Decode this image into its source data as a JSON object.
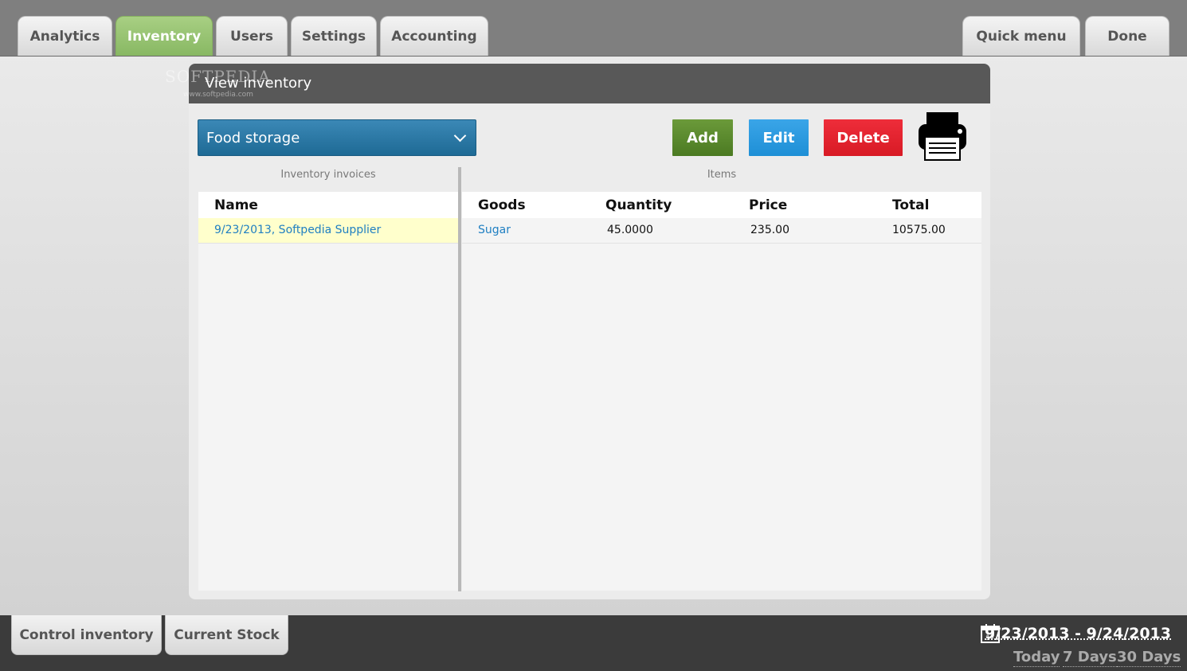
{
  "top_tabs": [
    {
      "label": "Analytics"
    },
    {
      "label": "Inventory"
    },
    {
      "label": "Users"
    },
    {
      "label": "Settings"
    },
    {
      "label": "Accounting"
    }
  ],
  "right_tabs": {
    "quick_menu": "Quick menu",
    "done": "Done"
  },
  "watermark": {
    "brand": "SOFTPEDIA",
    "url": "www.softpedia.com"
  },
  "panel": {
    "title": "View inventory"
  },
  "storage_select": {
    "selected": "Food storage"
  },
  "actions": {
    "add": "Add",
    "edit": "Edit",
    "delete": "Delete"
  },
  "invoices": {
    "section_label": "Inventory invoices",
    "column_header": "Name",
    "rows": [
      {
        "name": "9/23/2013, Softpedia Supplier"
      }
    ]
  },
  "items": {
    "section_label": "Items",
    "columns": [
      "Goods",
      "Quantity",
      "Price",
      "Total"
    ],
    "rows": [
      {
        "goods": "Sugar",
        "quantity": "45.0000",
        "price": "235.00",
        "total": "10575.00"
      }
    ]
  },
  "bottom_tabs": [
    {
      "label": "Control inventory"
    },
    {
      "label": "Current Stock"
    }
  ],
  "date_filter": {
    "range": "9/23/2013 - 9/24/2013",
    "calendar_day": "17",
    "quick_ranges": [
      "Today",
      "7 Days",
      "30 Days"
    ]
  },
  "colors": {
    "active_tab": "#9bc474",
    "add": "#5a8a2e",
    "edit": "#2a9ae0",
    "delete": "#e2222e",
    "dropdown": "#2a77a4",
    "selected_row": "#ffffcc",
    "link": "#1f7fc2"
  }
}
